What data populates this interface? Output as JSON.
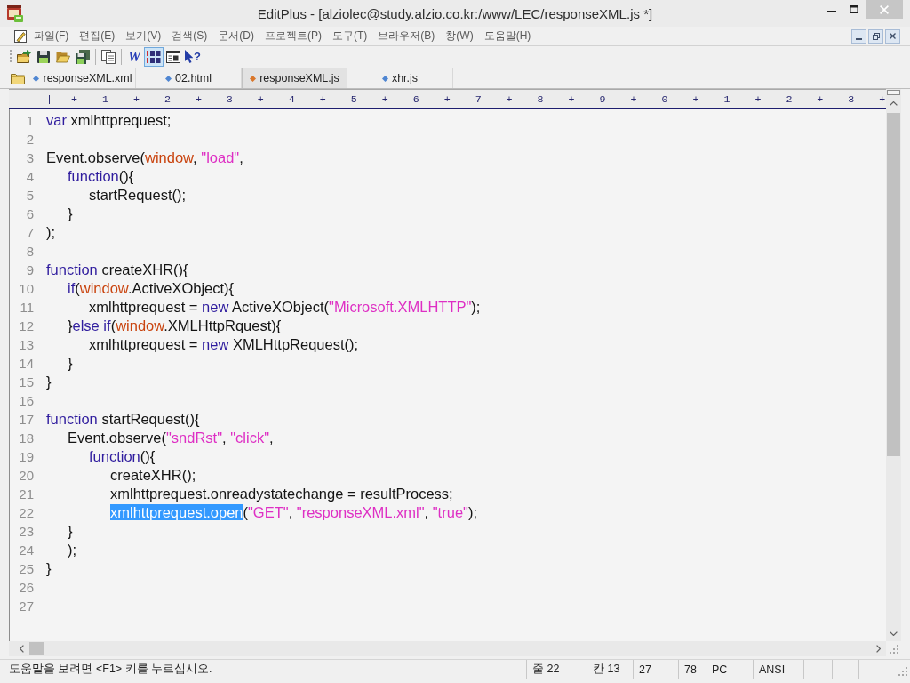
{
  "window": {
    "title": "EditPlus - [alziolec@study.alzio.co.kr:/www/LEC/responseXML.js *]"
  },
  "menu": [
    "파일(F)",
    "편집(E)",
    "보기(V)",
    "검색(S)",
    "문서(D)",
    "프로젝트(P)",
    "도구(T)",
    "브라우저(B)",
    "창(W)",
    "도움말(H)"
  ],
  "toolbar": [
    {
      "kind": "remote-open",
      "on": false
    },
    {
      "kind": "remote-save",
      "on": false
    },
    {
      "kind": "open",
      "on": false
    },
    {
      "kind": "save-all",
      "on": false
    },
    {
      "kind": "separator"
    },
    {
      "kind": "copy",
      "on": false
    },
    {
      "kind": "separator"
    },
    {
      "kind": "wrap",
      "label": "W",
      "on": false
    },
    {
      "kind": "line-numbers",
      "on": true
    },
    {
      "kind": "screen",
      "on": false
    },
    {
      "kind": "help",
      "label": "?",
      "on": false
    }
  ],
  "tabs": [
    {
      "label": "responseXML.xml",
      "selected": false,
      "color": "#4f86d2"
    },
    {
      "label": "02.html",
      "selected": false,
      "color": "#4f86d2"
    },
    {
      "label": "responseXML.js",
      "selected": true,
      "color": "#d9762a"
    },
    {
      "label": "xhr.js",
      "selected": false,
      "color": "#4f86d2"
    }
  ],
  "ruler": "|---+----1----+----2----+----3----+----4----+----5----+----6----+----7----+----8----+----9----+----0----+----1----+----2----+----3----+",
  "editor": {
    "lines": [
      {
        "number": "1",
        "tokens": [
          {
            "kind": "keyword",
            "text": "var"
          },
          {
            "kind": "plain",
            "text": " xmlhttprequest;"
          }
        ]
      },
      {
        "number": "2"
      },
      {
        "number": "3",
        "tokens": [
          {
            "kind": "plain",
            "text": "Event.observe("
          },
          {
            "kind": "object",
            "text": "window"
          },
          {
            "kind": "plain",
            "text": ", "
          },
          {
            "kind": "string",
            "text": "\"load\""
          },
          {
            "kind": "plain",
            "text": ","
          }
        ],
        "children": [
          {
            "number": "4",
            "tokens": [
              {
                "kind": "keyword",
                "text": "function"
              },
              {
                "kind": "plain",
                "text": "(){"
              }
            ],
            "children": [
              {
                "number": "5",
                "tokens": [
                  {
                    "kind": "plain",
                    "text": "startRequest();"
                  }
                ]
              }
            ]
          },
          {
            "number": "6",
            "tokens": [
              {
                "kind": "plain",
                "text": "}"
              }
            ]
          }
        ]
      },
      {
        "number": "7",
        "tokens": [
          {
            "kind": "plain",
            "text": ");"
          }
        ]
      },
      {
        "number": "8"
      },
      {
        "number": "9",
        "tokens": [
          {
            "kind": "keyword",
            "text": "function"
          },
          {
            "kind": "plain",
            "text": " createXHR(){"
          }
        ],
        "children": [
          {
            "number": "10",
            "tokens": [
              {
                "kind": "keyword",
                "text": "if"
              },
              {
                "kind": "plain",
                "text": "("
              },
              {
                "kind": "object",
                "text": "window"
              },
              {
                "kind": "plain",
                "text": ".ActiveXObject){"
              }
            ],
            "children": [
              {
                "number": "11",
                "tokens": [
                  {
                    "kind": "plain",
                    "text": "xmlhttprequest = "
                  },
                  {
                    "kind": "keyword",
                    "text": "new"
                  },
                  {
                    "kind": "plain",
                    "text": " ActiveXObject("
                  },
                  {
                    "kind": "string",
                    "text": "\"Microsoft.XMLHTTP\""
                  },
                  {
                    "kind": "plain",
                    "text": ");"
                  }
                ]
              }
            ]
          },
          {
            "number": "12",
            "tokens": [
              {
                "kind": "plain",
                "text": "}"
              },
              {
                "kind": "keyword",
                "text": "else if"
              },
              {
                "kind": "plain",
                "text": "("
              },
              {
                "kind": "object",
                "text": "window"
              },
              {
                "kind": "plain",
                "text": ".XMLHttpRquest){"
              }
            ],
            "children": [
              {
                "number": "13",
                "tokens": [
                  {
                    "kind": "plain",
                    "text": "xmlhttprequest = "
                  },
                  {
                    "kind": "keyword",
                    "text": "new"
                  },
                  {
                    "kind": "plain",
                    "text": " XMLHttpRequest();"
                  }
                ]
              }
            ]
          },
          {
            "number": "14",
            "tokens": [
              {
                "kind": "plain",
                "text": "}"
              }
            ]
          }
        ]
      },
      {
        "number": "15",
        "tokens": [
          {
            "kind": "plain",
            "text": "}"
          }
        ]
      },
      {
        "number": "16"
      },
      {
        "number": "17",
        "tokens": [
          {
            "kind": "keyword",
            "text": "function"
          },
          {
            "kind": "plain",
            "text": " startRequest(){"
          }
        ],
        "children": [
          {
            "number": "18",
            "tokens": [
              {
                "kind": "plain",
                "text": "Event.observe("
              },
              {
                "kind": "string",
                "text": "\"sndRst\""
              },
              {
                "kind": "plain",
                "text": ", "
              },
              {
                "kind": "string",
                "text": "\"click\""
              },
              {
                "kind": "plain",
                "text": ","
              }
            ],
            "children": [
              {
                "number": "19",
                "tokens": [
                  {
                    "kind": "keyword",
                    "text": "function"
                  },
                  {
                    "kind": "plain",
                    "text": "(){"
                  }
                ],
                "children": [
                  {
                    "number": "20",
                    "tokens": [
                      {
                        "kind": "plain",
                        "text": "createXHR();"
                      }
                    ]
                  },
                  {
                    "number": "21",
                    "tokens": [
                      {
                        "kind": "plain",
                        "text": "xmlhttprequest.onreadystatechange = resultProcess;"
                      }
                    ]
                  },
                  {
                    "number": "22",
                    "tokens": [
                      {
                        "kind": "selection",
                        "text": "xmlhttprequest.open"
                      },
                      {
                        "kind": "plain",
                        "text": "("
                      },
                      {
                        "kind": "string",
                        "text": "\"GET\""
                      },
                      {
                        "kind": "plain",
                        "text": ", "
                      },
                      {
                        "kind": "string",
                        "text": "\"responseXML.xml\""
                      },
                      {
                        "kind": "plain",
                        "text": ", "
                      },
                      {
                        "kind": "string",
                        "text": "\"true\""
                      },
                      {
                        "kind": "plain",
                        "text": ");"
                      }
                    ]
                  }
                ]
              }
            ]
          },
          {
            "number": "23",
            "tokens": [
              {
                "kind": "plain",
                "text": "}"
              }
            ]
          },
          {
            "number": "24",
            "tokens": [
              {
                "kind": "plain",
                "text": ");"
              }
            ]
          }
        ]
      },
      {
        "number": "25",
        "tokens": [
          {
            "kind": "plain",
            "text": "}"
          }
        ]
      },
      {
        "number": "26"
      },
      {
        "number": "27"
      }
    ]
  },
  "status_bar": {
    "message": "도움말을 보려면 <F1> 키를 누르십시오.",
    "fields": [
      "줄 22",
      "칸 13",
      "27",
      "78",
      "PC",
      "ANSI"
    ]
  }
}
